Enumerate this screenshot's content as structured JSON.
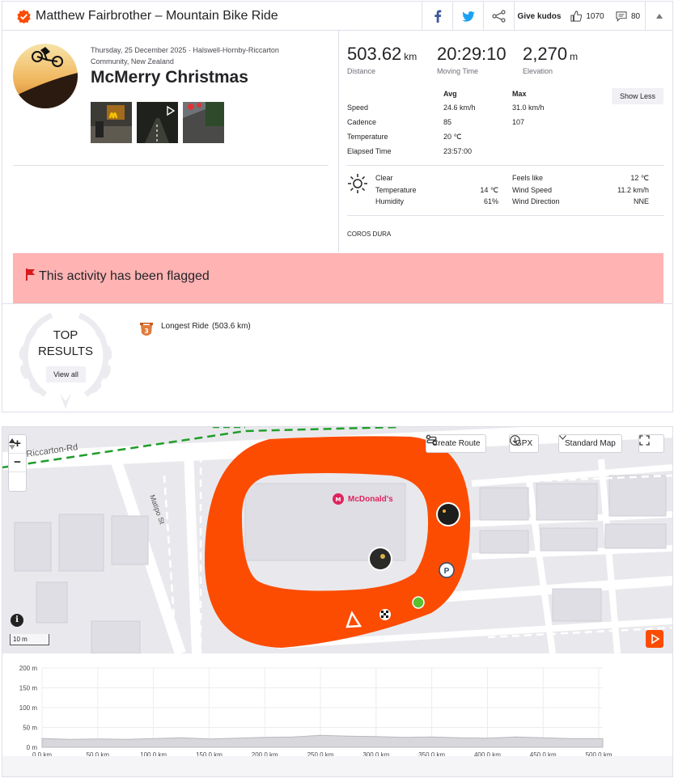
{
  "header": {
    "title": "Matthew Fairbrother – Mountain Bike Ride",
    "give_kudos": "Give kudos",
    "kudos_count": "1070",
    "comment_count": "80"
  },
  "activity": {
    "meta": "Thursday, 25 December 2025 · Halswell-Hornby-Riccarton Community, New Zealand",
    "name": "McMerry Christmas"
  },
  "stats": {
    "distance": {
      "value": "503.62",
      "unit": "km",
      "label": "Distance"
    },
    "moving_time": {
      "value": "20:29:10",
      "label": "Moving Time"
    },
    "elevation": {
      "value": "2,270",
      "unit": "m",
      "label": "Elevation"
    },
    "col_avg": "Avg",
    "col_max": "Max",
    "show_less": "Show Less",
    "rows": [
      {
        "label": "Speed",
        "avg": "24.6 km/h",
        "max": "31.0 km/h"
      },
      {
        "label": "Cadence",
        "avg": "85",
        "max": "107"
      },
      {
        "label": "Temperature",
        "avg": "20 ℃",
        "max": ""
      },
      {
        "label": "Elapsed Time",
        "avg": "23:57:00",
        "max": ""
      }
    ]
  },
  "weather": {
    "condition": "Clear",
    "temperature_label": "Temperature",
    "temperature": "14 ℃",
    "humidity_label": "Humidity",
    "humidity": "61%",
    "feels_like_label": "Feels like",
    "feels_like": "12 ℃",
    "wind_speed_label": "Wind Speed",
    "wind_speed": "11.2 km/h",
    "wind_dir_label": "Wind Direction",
    "wind_dir": "NNE"
  },
  "device": "COROS DURA",
  "flagged_text": "This activity has been flagged",
  "top_results": {
    "title_line1": "TOP",
    "title_line2": "RESULTS",
    "view_all": "View all",
    "achievement_rank": "3",
    "achievement": "Longest Ride",
    "achievement_value": "(503.6 km)"
  },
  "map": {
    "create_route": "Create Route",
    "gpx": "GPX",
    "map_type": "Standard Map",
    "road_1": "Riccarton-Rd",
    "road_2": "Matipo St",
    "poi": "McDonald's",
    "scale": "10 m",
    "info": "i",
    "route_color": "#fc4c02"
  },
  "chart_data": {
    "type": "area",
    "y_ticks": [
      "0 m",
      "50 m",
      "100 m",
      "150 m",
      "200 m"
    ],
    "x_ticks": [
      "0.0 km",
      "50.0 km",
      "100.0 km",
      "150.0 km",
      "200.0 km",
      "250.0 km",
      "300.0 km",
      "350.0 km",
      "400.0 km",
      "450.0 km",
      "500.0 km"
    ],
    "ylim": [
      0,
      200
    ],
    "xlim": [
      0,
      503.6
    ],
    "x": [
      0,
      25,
      50,
      75,
      100,
      125,
      150,
      175,
      200,
      225,
      250,
      275,
      300,
      325,
      350,
      375,
      400,
      425,
      450,
      475,
      503.6
    ],
    "values": [
      22,
      20,
      21,
      20,
      22,
      24,
      21,
      23,
      25,
      26,
      30,
      28,
      27,
      25,
      26,
      24,
      23,
      26,
      24,
      22,
      22
    ],
    "grid": true
  }
}
